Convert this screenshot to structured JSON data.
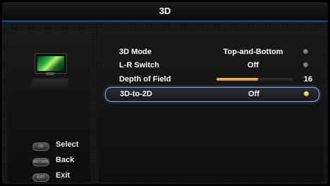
{
  "window": {
    "title": "3D"
  },
  "menu": {
    "items": [
      {
        "label": "3D Mode",
        "value": "Top-and-Bottom"
      },
      {
        "label": "L-R Switch",
        "value": "Off"
      },
      {
        "label": "Depth of Field",
        "value": "16",
        "level_fraction": 0.55
      },
      {
        "label": "3D-to-2D",
        "value": "Off",
        "selected": true
      }
    ]
  },
  "legend": {
    "items": [
      {
        "key": "OK",
        "label": "Select"
      },
      {
        "key": "RETURN",
        "label": "Back"
      },
      {
        "key": "EXIT",
        "label": "Exit"
      }
    ]
  },
  "colors": {
    "accent": "#1a4e86",
    "slider": "#e8a040",
    "selection_border": "#7fa6d8"
  }
}
